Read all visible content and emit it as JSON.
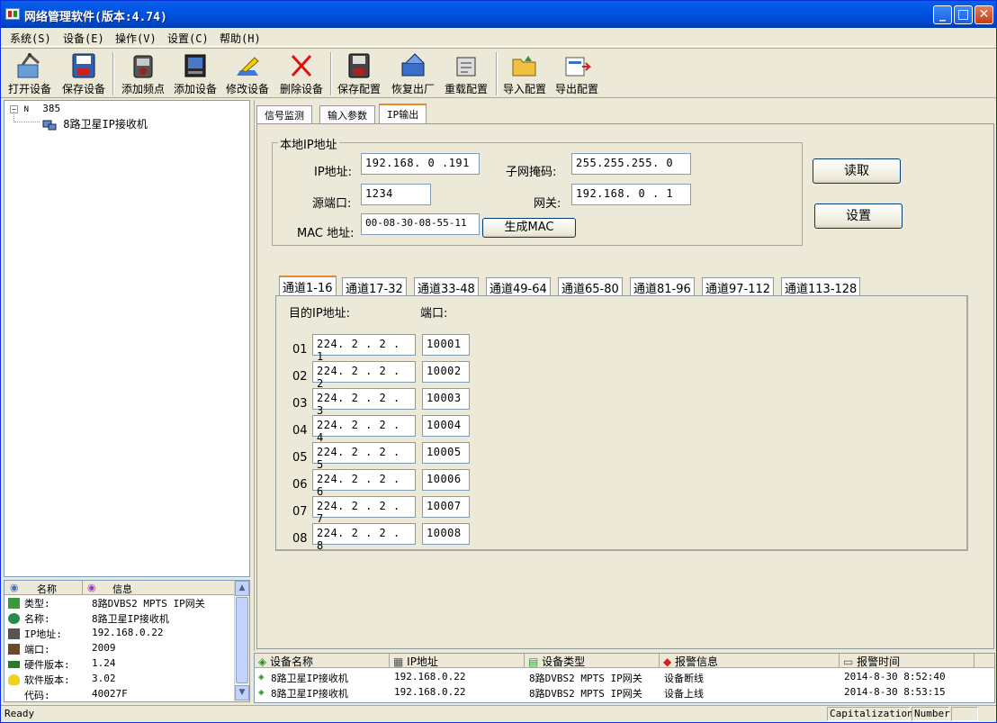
{
  "window": {
    "title": "网络管理软件(版本:4.74)"
  },
  "menu": [
    "系统(S)",
    "设备(E)",
    "操作(V)",
    "设置(C)",
    "帮助(H)"
  ],
  "toolbar": {
    "open_device": "打开设备",
    "save_device": "保存设备",
    "add_freq": "添加频点",
    "add_device": "添加设备",
    "modify_device": "修改设备",
    "delete_device": "删除设备",
    "save_config": "保存配置",
    "restore_factory": "恢复出厂",
    "reload_config": "重载配置",
    "import_config": "导入配置",
    "export_config": "导出配置"
  },
  "tree": {
    "root": "385",
    "child": "8路卫星IP接收机"
  },
  "info_panel": {
    "headers": {
      "name": "名称",
      "info": "信息"
    },
    "rows": [
      {
        "key": "类型:",
        "value": "8路DVBS2 MPTS IP网关"
      },
      {
        "key": "名称:",
        "value": "8路卫星IP接收机"
      },
      {
        "key": "IP地址:",
        "value": "192.168.0.22"
      },
      {
        "key": "端口:",
        "value": "2009"
      },
      {
        "key": "硬件版本:",
        "value": "1.24"
      },
      {
        "key": "软件版本:",
        "value": "3.02"
      },
      {
        "key": "代码:",
        "value": "40027F"
      }
    ]
  },
  "tabs": [
    "信号监测",
    "输入参数",
    "IP输出"
  ],
  "local_ip": {
    "group_label": "本地IP地址",
    "ip_label": "IP地址:",
    "ip_value": "192.168. 0 .191",
    "mask_label": "子网掩码:",
    "mask_value": "255.255.255. 0",
    "port_label": "源端口:",
    "port_value": "1234",
    "gateway_label": "网关:",
    "gateway_value": "192.168. 0 . 1",
    "mac_label": "MAC 地址:",
    "mac_value": "00-08-30-08-55-11",
    "gen_mac_button": "生成MAC"
  },
  "buttons": {
    "read": "读取",
    "set": "设置"
  },
  "channel_tabs": [
    "通道1-16",
    "通道17-32",
    "通道33-48",
    "通道49-64",
    "通道65-80",
    "通道81-96",
    "通道97-112",
    "通道113-128"
  ],
  "channels": {
    "dest_ip_header": "目的IP地址:",
    "port_header": "端口:",
    "rows": [
      {
        "num": "01",
        "ip": "224. 2 . 2 . 1",
        "port": "10001"
      },
      {
        "num": "02",
        "ip": "224. 2 . 2 . 2",
        "port": "10002"
      },
      {
        "num": "03",
        "ip": "224. 2 . 2 . 3",
        "port": "10003"
      },
      {
        "num": "04",
        "ip": "224. 2 . 2 . 4",
        "port": "10004"
      },
      {
        "num": "05",
        "ip": "224. 2 . 2 . 5",
        "port": "10005"
      },
      {
        "num": "06",
        "ip": "224. 2 . 2 . 6",
        "port": "10006"
      },
      {
        "num": "07",
        "ip": "224. 2 . 2 . 7",
        "port": "10007"
      },
      {
        "num": "08",
        "ip": "224. 2 . 2 . 8",
        "port": "10008"
      }
    ]
  },
  "alarm_list": {
    "headers": [
      "设备名称",
      "IP地址",
      "设备类型",
      "报警信息",
      "报警时间"
    ],
    "rows": [
      {
        "name": "8路卫星IP接收机",
        "ip": "192.168.0.22",
        "type": "8路DVBS2 MPTS IP网关",
        "alarm": "设备断线",
        "time": "2014-8-30 8:52:40"
      },
      {
        "name": "8路卫星IP接收机",
        "ip": "192.168.0.22",
        "type": "8路DVBS2 MPTS IP网关",
        "alarm": "设备上线",
        "time": "2014-8-30 8:53:15"
      }
    ]
  },
  "status": {
    "left": "Ready",
    "cap": "Capitalization",
    "num": "Number"
  }
}
